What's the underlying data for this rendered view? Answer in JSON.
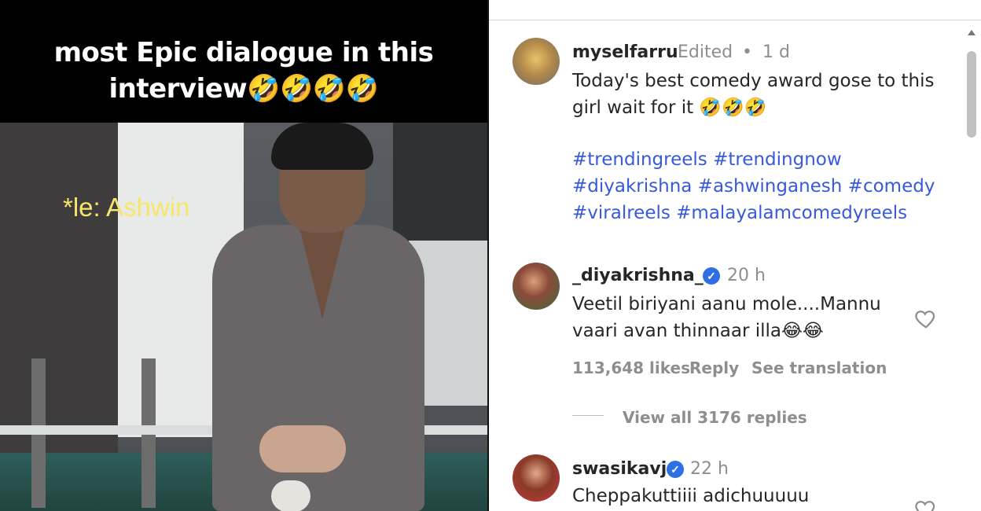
{
  "video": {
    "caption_line1": "most Epic dialogue in this",
    "caption_line2": "interview🤣🤣🤣🤣",
    "overlay_text": "*le: Ashwin"
  },
  "comments": [
    {
      "username": "myselfarru",
      "edited": "Edited",
      "dot": "•",
      "time": "1 d",
      "text_line1": "Today's best comedy award gose to this",
      "text_line2": "girl wait for it 🤣🤣🤣",
      "hashtags_line1": "#trendingreels #trendingnow",
      "hashtags_line2": "#diyakrishna #ashwinganesh #comedy",
      "hashtags_line3": "#viralreels #malayalamcomedyreels"
    },
    {
      "username": "_diyakrishna_",
      "verified": true,
      "time": "20 h",
      "text_line1": "Veetil biriyani aanu mole....Mannu",
      "text_line2": "vaari avan thinnaar illa😂😂",
      "likes": "113,648 likes",
      "reply_label": "Reply",
      "translate_label": "See translation",
      "view_replies": "View all 3176 replies"
    },
    {
      "username": "swasikavj",
      "verified": true,
      "time": "22 h",
      "text_line1": "Cheppakuttiiii adichuuuuu"
    }
  ],
  "colors": {
    "hashtag": "#385ad8",
    "verified": "#2f6fe4",
    "overlay_text": "#f7e66a"
  },
  "icons": [
    "verified-badge-icon",
    "heart-icon"
  ]
}
